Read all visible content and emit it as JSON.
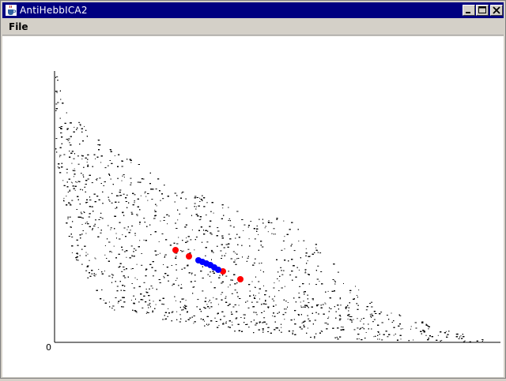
{
  "window": {
    "title": "AntiHebbICA2",
    "icon": "java-coffee-cup-icon",
    "controls": [
      "minimize-icon",
      "maximize-icon",
      "close-icon"
    ]
  },
  "menubar": {
    "items": [
      {
        "label": "File"
      }
    ]
  },
  "plot": {
    "axis_origin_label": "0",
    "colors": {
      "points": "#000000",
      "red_markers": "#ff0000",
      "blue_markers": "#0000ff",
      "axes": "#000000",
      "background": "#ffffff"
    }
  }
}
